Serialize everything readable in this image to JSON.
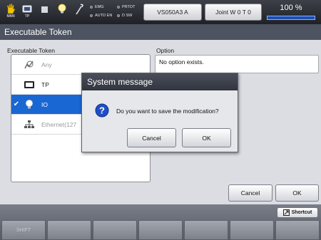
{
  "statusbar": {
    "mode_icons": [
      {
        "icon": "hand-icon",
        "label": "MAN"
      },
      {
        "icon": "teach-pendant-icon",
        "label": "TP"
      },
      {
        "icon": "square-icon",
        "label": ""
      },
      {
        "icon": "bulb-icon",
        "label": ""
      },
      {
        "icon": "wrench-icon",
        "label": ""
      }
    ],
    "indicators": {
      "emg": "EMG",
      "auto_en": "AUTO EN",
      "prtot": "PRTOT",
      "d_sw": "D SW"
    },
    "robot_label": "VS050A3 A",
    "joint_label": "Joint W 0 T 0",
    "speed_label": "100 %",
    "speed_fraction": 1.0
  },
  "page": {
    "title": "Executable Token"
  },
  "token_list": {
    "label": "Executable Token",
    "items": [
      {
        "icon": "any-icon",
        "label": "Any",
        "selected": false
      },
      {
        "icon": "teach-pendant-icon",
        "label": "TP",
        "selected": false
      },
      {
        "icon": "bulb-icon",
        "label": "IO",
        "selected": true
      },
      {
        "icon": "network-icon",
        "label": "Ethernet(127",
        "selected": false
      }
    ]
  },
  "option": {
    "label": "Option",
    "value": "No option exists."
  },
  "footer": {
    "cancel_label": "Cancel",
    "ok_label": "OK",
    "shortcut_label": "Shortcut"
  },
  "function_keys": [
    "SHIFT",
    "",
    "",
    "",
    "",
    "",
    ""
  ],
  "dialog": {
    "title": "System message",
    "message": "Do you want to save the modification?",
    "icon": "question-icon",
    "cancel_label": "Cancel",
    "ok_label": "OK"
  },
  "colors": {
    "selection": "#1967d2",
    "titlebar": "#4d5360",
    "question": "#1e4fc8"
  }
}
